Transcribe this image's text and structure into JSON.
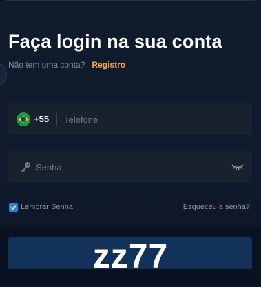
{
  "header": {
    "title": "Faça login na sua conta",
    "no_account_text": "Não tem uma conta?",
    "register_link": "Registro"
  },
  "phone_field": {
    "country_code": "+55",
    "placeholder": "Telefone",
    "flag_icon": "brazil-flag-icon"
  },
  "password_field": {
    "placeholder": "Senha",
    "key_icon": "key-icon",
    "eye_icon": "eye-closed-icon"
  },
  "remember": {
    "label": "Lembrar Senha",
    "checked": true
  },
  "forgot_link": "Esqueceu a senha?",
  "watermark": "zz77",
  "colors": {
    "background": "#0f1a2c",
    "field": "#1a212e",
    "accent_link": "#f7a53b",
    "checkbox": "#2f7fe0",
    "button": "#12325a"
  }
}
